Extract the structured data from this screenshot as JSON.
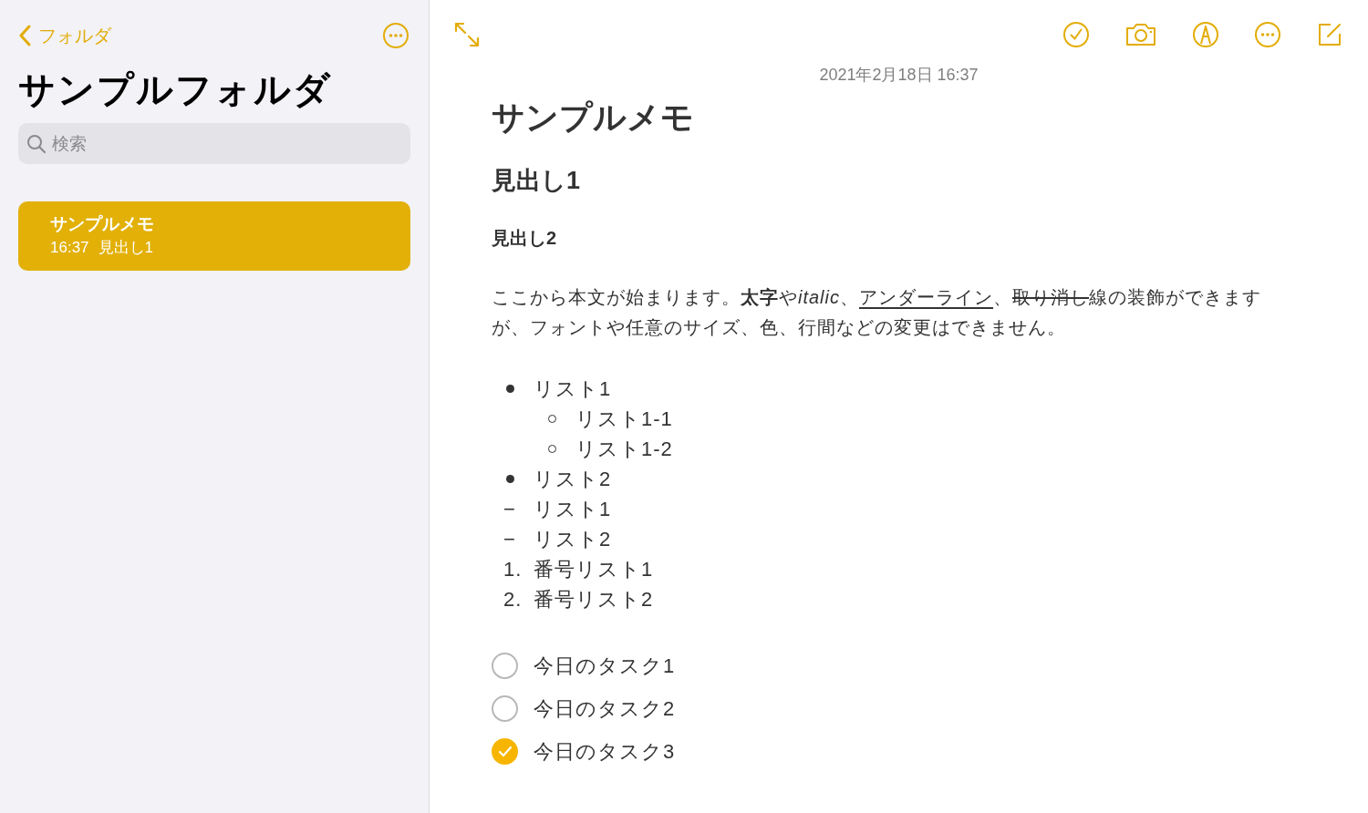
{
  "sidebar": {
    "back_label": "フォルダ",
    "title": "サンプルフォルダ",
    "search": {
      "placeholder": "検索"
    },
    "notes": [
      {
        "title": "サンプルメモ",
        "time": "16:37",
        "preview": "見出し1",
        "selected": true
      }
    ]
  },
  "note": {
    "date": "2021年2月18日 16:37",
    "title": "サンプルメモ",
    "heading1": "見出し1",
    "heading2": "見出し2",
    "paragraph": [
      {
        "kind": "plain",
        "text": "ここから本文が始まります。"
      },
      {
        "kind": "bold",
        "text": "太字"
      },
      {
        "kind": "plain",
        "text": "や"
      },
      {
        "kind": "italic",
        "text": "italic"
      },
      {
        "kind": "plain",
        "text": "、"
      },
      {
        "kind": "underline",
        "text": "アンダーライン"
      },
      {
        "kind": "plain",
        "text": "、"
      },
      {
        "kind": "strike",
        "text": "取り消し"
      },
      {
        "kind": "plain",
        "text": "線の装飾ができますが、フォントや任意のサイズ、色、行間などの変更はできません。"
      }
    ],
    "list": [
      {
        "kind": "bullet",
        "text": "リスト1",
        "children": [
          {
            "kind": "circle",
            "text": "リスト1-1"
          },
          {
            "kind": "circle",
            "text": "リスト1-2"
          }
        ]
      },
      {
        "kind": "bullet",
        "text": "リスト2"
      },
      {
        "kind": "dash",
        "marker": "−",
        "text": "リスト1"
      },
      {
        "kind": "dash",
        "marker": "−",
        "text": "リスト2"
      },
      {
        "kind": "number",
        "marker": "1.",
        "text": "番号リスト1"
      },
      {
        "kind": "number",
        "marker": "2.",
        "text": "番号リスト2"
      }
    ],
    "tasks": [
      {
        "text": "今日のタスク1",
        "checked": false
      },
      {
        "text": "今日のタスク2",
        "checked": false
      },
      {
        "text": "今日のタスク3",
        "checked": true
      }
    ]
  }
}
